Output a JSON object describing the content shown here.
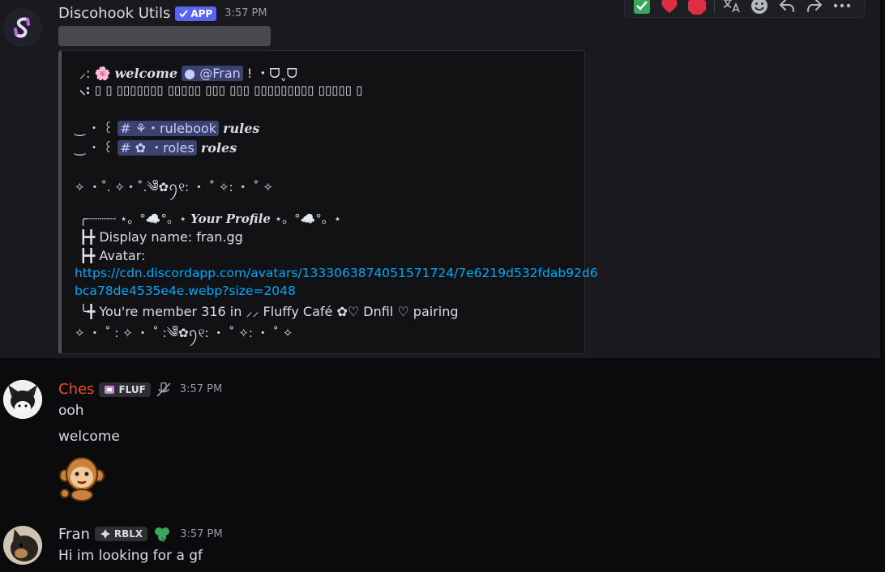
{
  "colors": {
    "ches_name": "#f04d22",
    "app_tag": "#5865f2",
    "link": "#00a8fc"
  },
  "toolbar": {
    "icons": [
      "check-reaction-icon",
      "heart-reaction-icon",
      "stop-reaction-icon",
      "translate-icon",
      "add-reaction-icon",
      "reply-icon",
      "forward-icon",
      "more-icon"
    ],
    "reactions": [
      "✅",
      "❤",
      "🛑"
    ]
  },
  "msg1": {
    "author": "Discohook Utils",
    "app_tag": "APP",
    "time": "3:57 PM",
    "embed": {
      "welcome_prefix": "⸝: 🌸",
      "welcome_word": "welcome",
      "mention": "@Fran",
      "welcome_suffix": "! ・ᗜˬᗜ",
      "second_line": "⸜: ▯ ▯ ▯▯▯▯▯▯▯ ▯▯▯▯▯ ▯▯▯ ▯▯▯ ▯▯▯▯▯▯▯▯▯ ▯▯▯▯▯ ▯",
      "rulebook_prefix": "‿ ・ ꒰",
      "rulebook_channel": "# ⚘・rulebook",
      "rulebook_suffix": "rules",
      "roles_prefix": "‿ ・ ꒰",
      "roles_channel": "# ✿ ・roles",
      "roles_suffix": "roles",
      "divider": "✧ ・˚. ✧・˚.༄ᩚ✿ꪆ୧: ・ ˚ ✧: ・ ˚ ✧",
      "profile_line": "╭┈┈┈┈ ⋆。°☁️°。⋆",
      "profile_word": "Your Profile",
      "profile_end": "⋆。°☁️°。⋆",
      "display_name_line": "┣╋ Display name: fran.gg",
      "avatar_label": "┣╋ Avatar:",
      "avatar_url_1": "https://cdn.discordapp.com/avatars/1333063874051571724/7e6219d532fdab92d6",
      "avatar_url_2": "bca78de4535e4e.webp?size=2048",
      "member_line": "╰╋ You're member 316 in ⸝⸝ Fluffy Café ✿♡ Dnfil ♡ pairing",
      "divider2": "✧ ・ ˚ : ✧ ・ ˚ :༄ᩚ✿ꪆ୧: ・ ˚ ✧: ・ ˚ ✧"
    }
  },
  "msg2": {
    "author": "Ches",
    "role_tag": "FLUF",
    "time": "3:57 PM",
    "lines": [
      "ooh",
      "welcome"
    ],
    "sticker": "monkey-sticker"
  },
  "msg3": {
    "author": "Fran",
    "role_tag": "RBLX",
    "time": "3:57 PM",
    "lines": [
      "Hi im looking for a gf"
    ]
  }
}
